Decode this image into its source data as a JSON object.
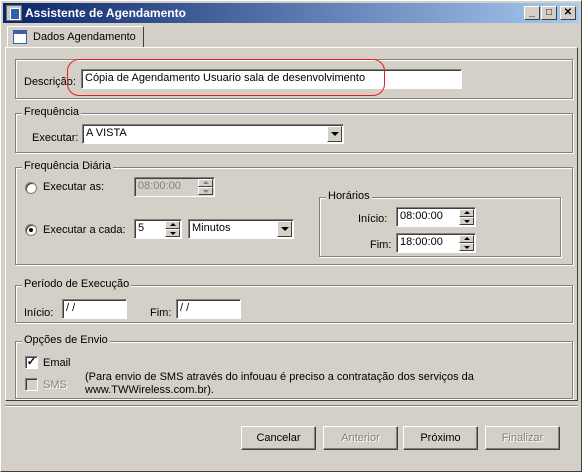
{
  "window": {
    "title": "Assistente de Agendamento",
    "minimize_label": "_",
    "maximize_label": "□",
    "close_label": "✕"
  },
  "tabs": [
    {
      "label": "Dados Agendamento"
    }
  ],
  "descricao": {
    "label": "Descrição:",
    "value": "Cópia de Agendamento Usuario sala de desenvolvimento"
  },
  "frequencia": {
    "legend": "Frequência",
    "executar_label": "Executar:",
    "executar_value": "A VISTA"
  },
  "frequencia_diaria": {
    "legend": "Frequência Diária",
    "executar_as_label": "Executar as:",
    "executar_as_value": "08:00:00",
    "executar_a_cada_label": "Executar a cada:",
    "intervalo_value": "5",
    "unidade_value": "Minutos",
    "horarios": {
      "legend": "Horários",
      "inicio_label": "Início:",
      "inicio_value": "08:00:00",
      "fim_label": "Fim:",
      "fim_value": "18:00:00"
    }
  },
  "periodo": {
    "legend": "Período de Execução",
    "inicio_label": "Início:",
    "inicio_value": " / /",
    "fim_label": "Fim:",
    "fim_value": " / /"
  },
  "opcoes_envio": {
    "legend": "Opções de Envio",
    "email_label": "Email",
    "email_checked": true,
    "sms_label": "SMS",
    "sms_checked": false,
    "note_line1": "(Para envio de SMS através do infouau é preciso a contratação dos serviços da",
    "note_line2": "www.TWWireless.com.br)."
  },
  "buttons": {
    "cancelar": "Cancelar",
    "anterior": "Anterior",
    "proximo": "Próximo",
    "finalizar": "Finalizar"
  },
  "colors": {
    "titlebar_start": "#0a246a",
    "titlebar_end": "#a6caf0",
    "highlight": "#e02020",
    "face": "#d4d0c8"
  }
}
